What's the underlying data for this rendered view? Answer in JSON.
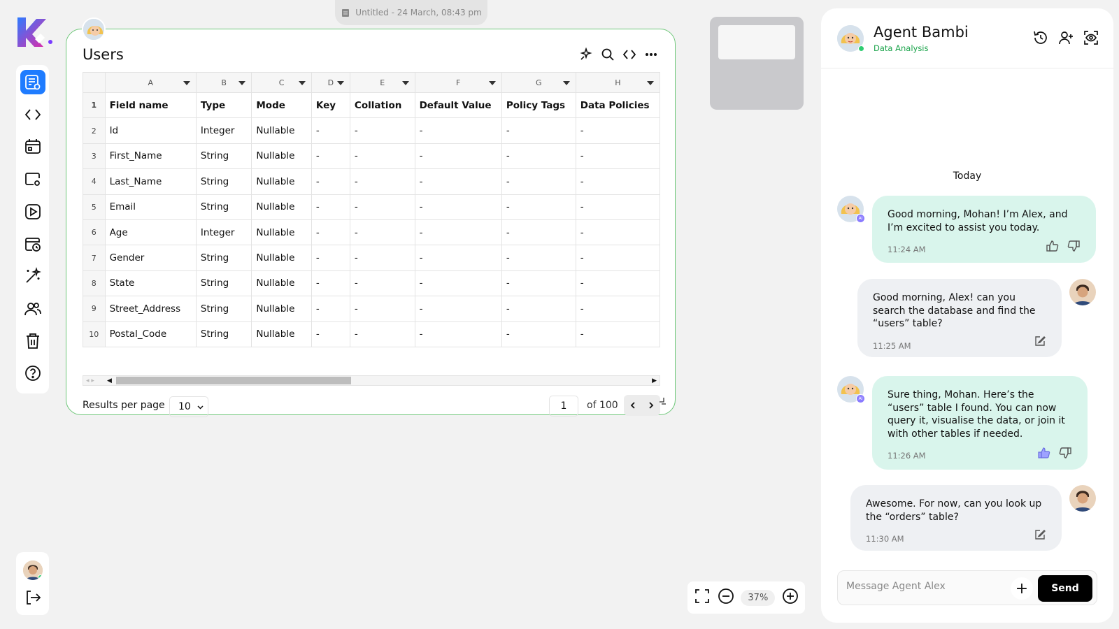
{
  "doc_title": "Untitled - 24 March, 08:43 pm",
  "sidebar": {
    "items": [
      {
        "name": "table-view-icon",
        "active": true
      },
      {
        "name": "code-icon"
      },
      {
        "name": "calendar-card-icon"
      },
      {
        "name": "settings-screen-icon"
      },
      {
        "name": "play-icon"
      },
      {
        "name": "schedule-icon"
      },
      {
        "name": "magic-wand-icon"
      },
      {
        "name": "users-icon"
      },
      {
        "name": "trash-icon"
      },
      {
        "name": "help-icon"
      }
    ]
  },
  "table_card": {
    "title": "Users",
    "columns": [
      "A",
      "B",
      "C",
      "D",
      "E",
      "F",
      "G",
      "H"
    ],
    "rows": [
      [
        "Field name",
        "Type",
        "Mode",
        "Key",
        "Collation",
        "Default Value",
        "Policy Tags",
        "Data Policies"
      ],
      [
        "Id",
        "Integer",
        "Nullable",
        "-",
        "-",
        "-",
        "-",
        "-"
      ],
      [
        "First_Name",
        "String",
        "Nullable",
        "-",
        "-",
        "-",
        "-",
        "-"
      ],
      [
        "Last_Name",
        "String",
        "Nullable",
        "-",
        "-",
        "-",
        "-",
        "-"
      ],
      [
        "Email",
        "String",
        "Nullable",
        "-",
        "-",
        "-",
        "-",
        "-"
      ],
      [
        "Age",
        "Integer",
        "Nullable",
        "-",
        "-",
        "-",
        "-",
        "-"
      ],
      [
        "Gender",
        "String",
        "Nullable",
        "-",
        "-",
        "-",
        "-",
        "-"
      ],
      [
        "State",
        "String",
        "Nullable",
        "-",
        "-",
        "-",
        "-",
        "-"
      ],
      [
        "Street_Address",
        "String",
        "Nullable",
        "-",
        "-",
        "-",
        "-",
        "-"
      ],
      [
        "Postal_Code",
        "String",
        "Nullable",
        "-",
        "-",
        "-",
        "-",
        "-"
      ]
    ],
    "results_per_page_label": "Results per page",
    "results_per_page_value": "10",
    "page_value": "1",
    "page_of": "of 100"
  },
  "zoom": {
    "percent": "37%"
  },
  "chat": {
    "agent_name": "Agent Bambi",
    "agent_role": "Data Analysis",
    "today_label": "Today",
    "messages": [
      {
        "from": "ai",
        "text": "Good morning, Mohan! I’m Alex, and I’m excited to assist you today.",
        "time": "11:24 AM"
      },
      {
        "from": "user",
        "text": "Good morning, Alex! can you search the database and find the “users” table?",
        "time": "11:25 AM"
      },
      {
        "from": "ai",
        "text": "Sure thing, Mohan. Here’s the “users” table I found. You can now query it, visualise the data, or join it with other tables if needed.",
        "time": "11:26 AM"
      },
      {
        "from": "user",
        "text": "Awesome. For now, can you look up the “orders” table?",
        "time": "11:30 AM"
      }
    ],
    "composer_placeholder": "Message Agent Alex",
    "send_label": "Send"
  },
  "colors": {
    "accent": "#1f7cff",
    "card_border": "#6fc77a",
    "ai_bubble": "#d9f5ec",
    "user_bubble": "#eef0f3",
    "online": "#2ecc71"
  }
}
